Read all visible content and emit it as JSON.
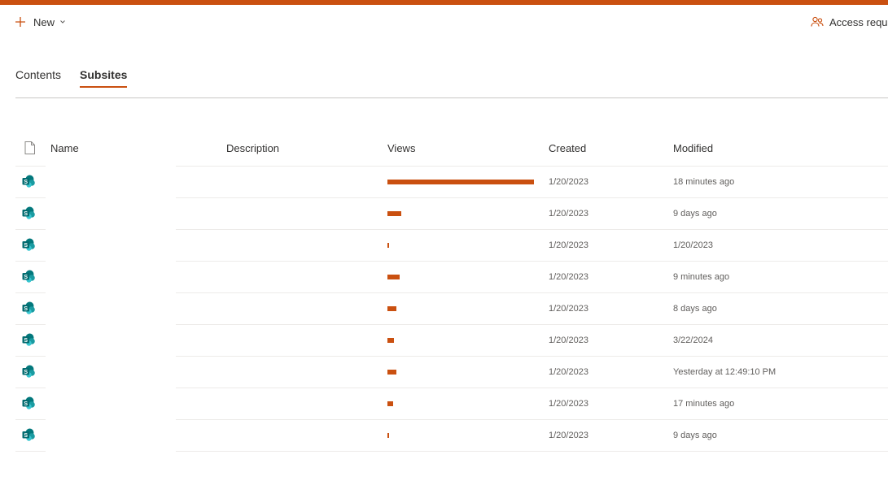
{
  "colors": {
    "accent": "#ca5010",
    "site_icon": "#038387"
  },
  "commandbar": {
    "new_label": "New",
    "access_label": "Access reque"
  },
  "tabs": [
    {
      "label": "Contents",
      "active": false
    },
    {
      "label": "Subsites",
      "active": true
    }
  ],
  "columns": {
    "name": "Name",
    "description": "Description",
    "views": "Views",
    "created": "Created",
    "modified": "Modified"
  },
  "rows": [
    {
      "views_fraction": 1.0,
      "created": "1/20/2023",
      "modified": "18 minutes ago"
    },
    {
      "views_fraction": 0.094,
      "created": "1/20/2023",
      "modified": "9 days ago"
    },
    {
      "views_fraction": 0.011,
      "created": "1/20/2023",
      "modified": "1/20/2023"
    },
    {
      "views_fraction": 0.083,
      "created": "1/20/2023",
      "modified": "9 minutes ago"
    },
    {
      "views_fraction": 0.061,
      "created": "1/20/2023",
      "modified": "8 days ago"
    },
    {
      "views_fraction": 0.044,
      "created": "1/20/2023",
      "modified": "3/22/2024"
    },
    {
      "views_fraction": 0.061,
      "created": "1/20/2023",
      "modified": "Yesterday at 12:49:10 PM"
    },
    {
      "views_fraction": 0.039,
      "created": "1/20/2023",
      "modified": "17 minutes ago"
    },
    {
      "views_fraction": 0.011,
      "created": "1/20/2023",
      "modified": "9 days ago"
    }
  ]
}
